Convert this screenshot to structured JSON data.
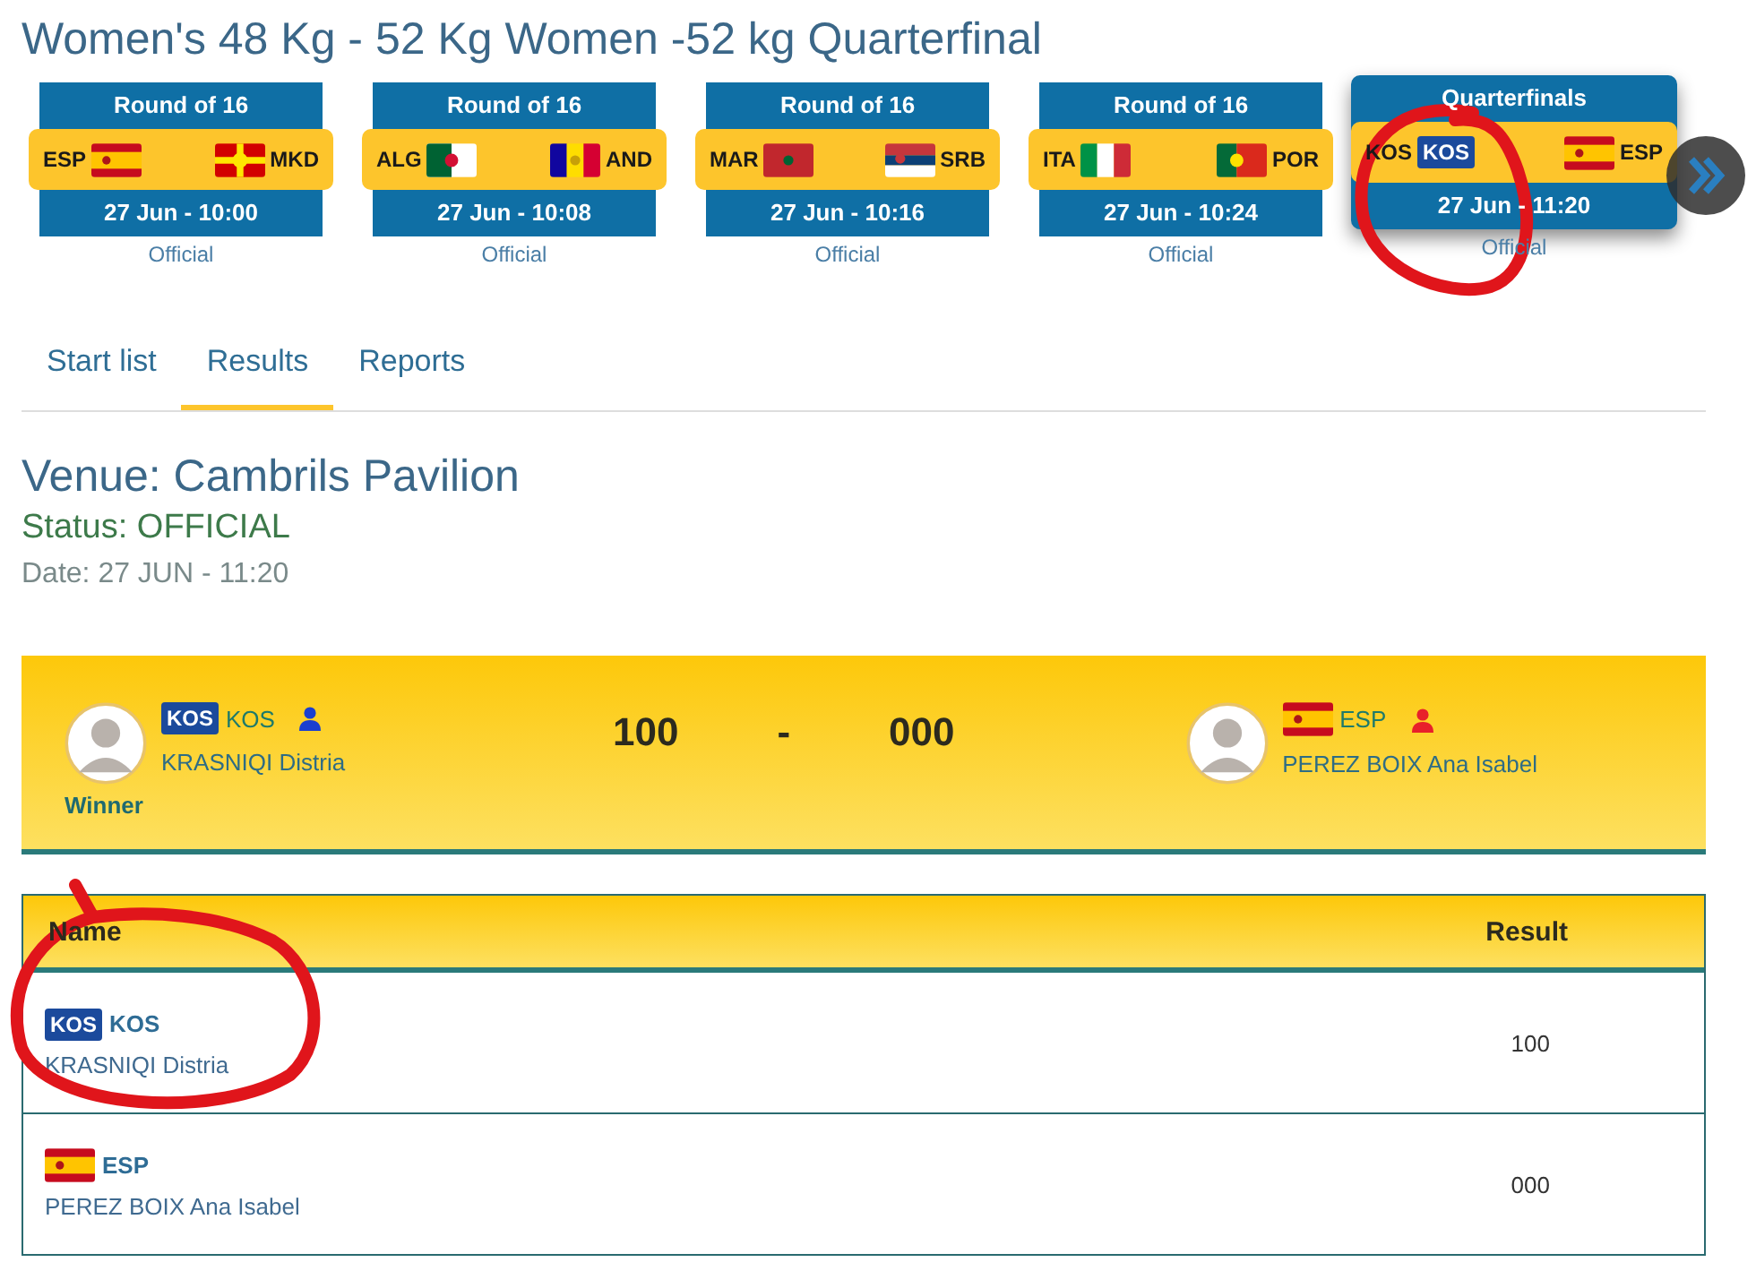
{
  "title": "Women's 48 Kg - 52 Kg Women -52 kg Quarterfinal",
  "matches": [
    {
      "round": "Round of 16",
      "teams": [
        {
          "code": "ESP",
          "kind": "spain"
        },
        {
          "code": "MKD",
          "kind": "macedonia"
        }
      ],
      "time": "27 Jun - 10:00",
      "status": "Official",
      "selected": false
    },
    {
      "round": "Round of 16",
      "teams": [
        {
          "code": "ALG",
          "kind": "algeria"
        },
        {
          "code": "AND",
          "kind": "andorra"
        }
      ],
      "time": "27 Jun - 10:08",
      "status": "Official",
      "selected": false
    },
    {
      "round": "Round of 16",
      "teams": [
        {
          "code": "MAR",
          "kind": "morocco"
        },
        {
          "code": "SRB",
          "kind": "serbia"
        }
      ],
      "time": "27 Jun - 10:16",
      "status": "Official",
      "selected": false
    },
    {
      "round": "Round of 16",
      "teams": [
        {
          "code": "ITA",
          "kind": "italy"
        },
        {
          "code": "POR",
          "kind": "portugal"
        }
      ],
      "time": "27 Jun - 10:24",
      "status": "Official",
      "selected": false
    },
    {
      "round": "Quarterfinals",
      "teams": [
        {
          "code": "KOS",
          "kind": "badge",
          "flag_text": "KOS"
        },
        {
          "code": "ESP",
          "kind": "spain"
        }
      ],
      "time": "27 Jun - 11:20",
      "status": "Official",
      "selected": true
    }
  ],
  "tabs": [
    {
      "label": "Start list",
      "selected": false
    },
    {
      "label": "Results",
      "selected": true
    },
    {
      "label": "Reports",
      "selected": false
    }
  ],
  "venue": "Venue: Cambrils Pavilion",
  "status": "Status: OFFICIAL",
  "date": "Date: 27 JUN - 11:20",
  "scoreboard": {
    "athletes": [
      {
        "kind": "badge",
        "flag_text": "KOS",
        "code": "KOS",
        "name": "KRASNIQI Distria",
        "color": "#1a3fd0",
        "winner": "Winner"
      },
      {
        "kind": "spain",
        "code": "ESP",
        "name": "PEREZ BOIX Ana Isabel",
        "color": "#e8202a"
      }
    ],
    "scores": [
      "100",
      "-",
      "000"
    ]
  },
  "table": {
    "columns": [
      "Name",
      "Result"
    ],
    "rows": [
      {
        "kind": "badge",
        "flag_text": "KOS",
        "code": "KOS",
        "name": "KRASNIQI Distria",
        "result": "100"
      },
      {
        "kind": "spain",
        "code": "ESP",
        "name": "PEREZ BOIX Ana Isabel",
        "result": "000"
      }
    ]
  }
}
